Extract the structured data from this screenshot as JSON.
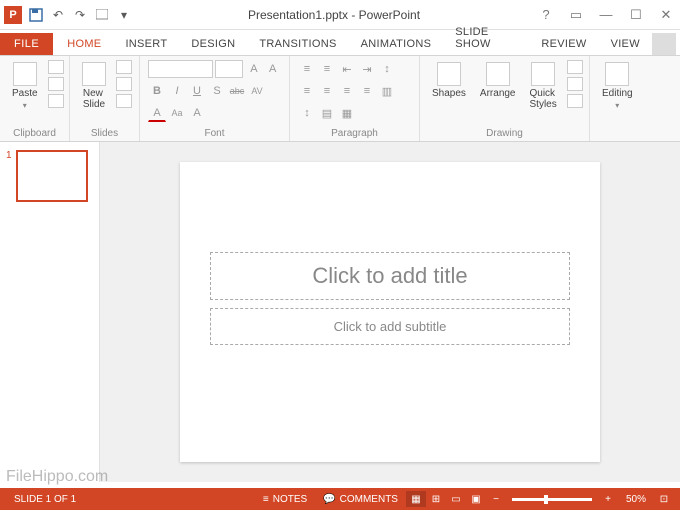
{
  "titlebar": {
    "title": "Presentation1.pptx - PowerPoint"
  },
  "tabs": {
    "file": "FILE",
    "items": [
      "HOME",
      "INSERT",
      "DESIGN",
      "TRANSITIONS",
      "ANIMATIONS",
      "SLIDE SHOW",
      "REVIEW",
      "VIEW"
    ],
    "active_index": 0
  },
  "ribbon": {
    "clipboard": {
      "label": "Clipboard",
      "paste": "Paste"
    },
    "slides": {
      "label": "Slides",
      "new_slide": "New\nSlide"
    },
    "font": {
      "label": "Font",
      "bold": "B",
      "italic": "I",
      "underline": "U",
      "shadow": "S",
      "strike": "abc",
      "spacing": "AV",
      "case": "Aa",
      "font_letter": "A"
    },
    "paragraph": {
      "label": "Paragraph"
    },
    "drawing": {
      "label": "Drawing",
      "shapes": "Shapes",
      "arrange": "Arrange",
      "quick_styles": "Quick\nStyles"
    },
    "editing": {
      "label": "Editing",
      "editing_btn": "Editing"
    }
  },
  "thumbnails": {
    "items": [
      {
        "num": "1"
      }
    ]
  },
  "slide": {
    "title_placeholder": "Click to add title",
    "subtitle_placeholder": "Click to add subtitle"
  },
  "statusbar": {
    "slide_count": "SLIDE 1 OF 1",
    "notes": "NOTES",
    "comments": "COMMENTS",
    "zoom": "50%"
  },
  "watermark": "FileHippo.com"
}
